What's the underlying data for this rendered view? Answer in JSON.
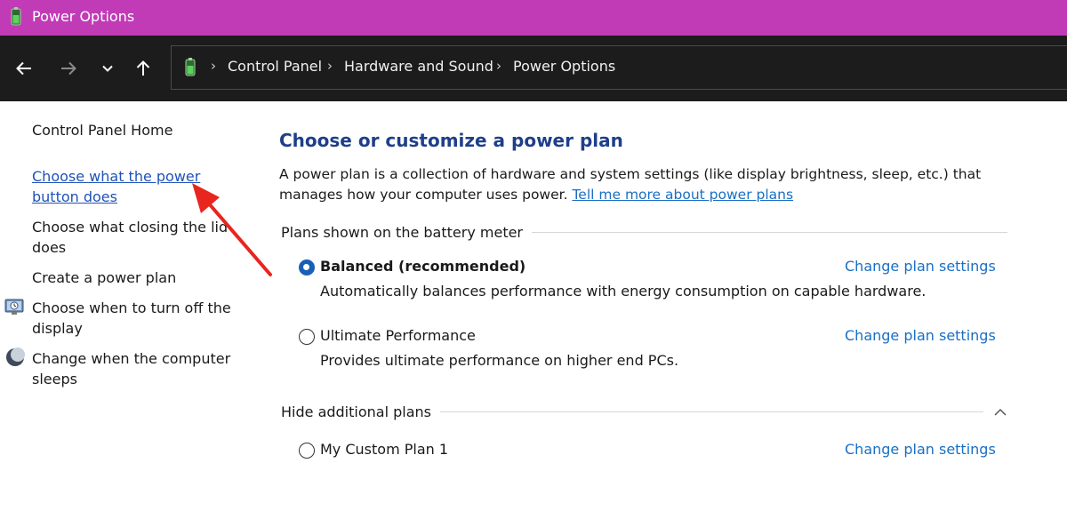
{
  "window": {
    "title": "Power Options"
  },
  "navigation": {
    "breadcrumb": [
      "Control Panel",
      "Hardware and Sound",
      "Power Options"
    ]
  },
  "sidebar": {
    "home": "Control Panel Home",
    "links": [
      {
        "label": "Choose what the power button does",
        "highlighted": true
      },
      {
        "label": "Choose what closing the lid does"
      },
      {
        "label": "Create a power plan"
      },
      {
        "label": "Choose when to turn off the display",
        "icon": "monitor-clock-icon"
      },
      {
        "label": "Change when the computer sleeps",
        "icon": "moon-sleep-icon"
      }
    ]
  },
  "main": {
    "heading": "Choose or customize a power plan",
    "description": "A power plan is a collection of hardware and system settings (like display brightness, sleep, etc.) that manages how your computer uses power.",
    "tell_more_link": "Tell me more about power plans",
    "battery_group": {
      "header": "Plans shown on the battery meter",
      "plans": [
        {
          "name": "Balanced (recommended)",
          "description": "Automatically balances performance with energy consumption on capable hardware.",
          "selected": true,
          "action": "Change plan settings"
        },
        {
          "name": "Ultimate Performance",
          "description": "Provides ultimate performance on higher end PCs.",
          "selected": false,
          "action": "Change plan settings"
        }
      ]
    },
    "additional_group": {
      "header": "Hide additional plans",
      "plans": [
        {
          "name": "My Custom Plan 1",
          "selected": false,
          "action": "Change plan settings"
        }
      ]
    }
  },
  "colors": {
    "titlebar": "#c13bb7",
    "navbar": "#1c1c1c",
    "heading": "#1e3f8a",
    "link": "#1a6fc4",
    "annotation_arrow": "#e8251f"
  }
}
